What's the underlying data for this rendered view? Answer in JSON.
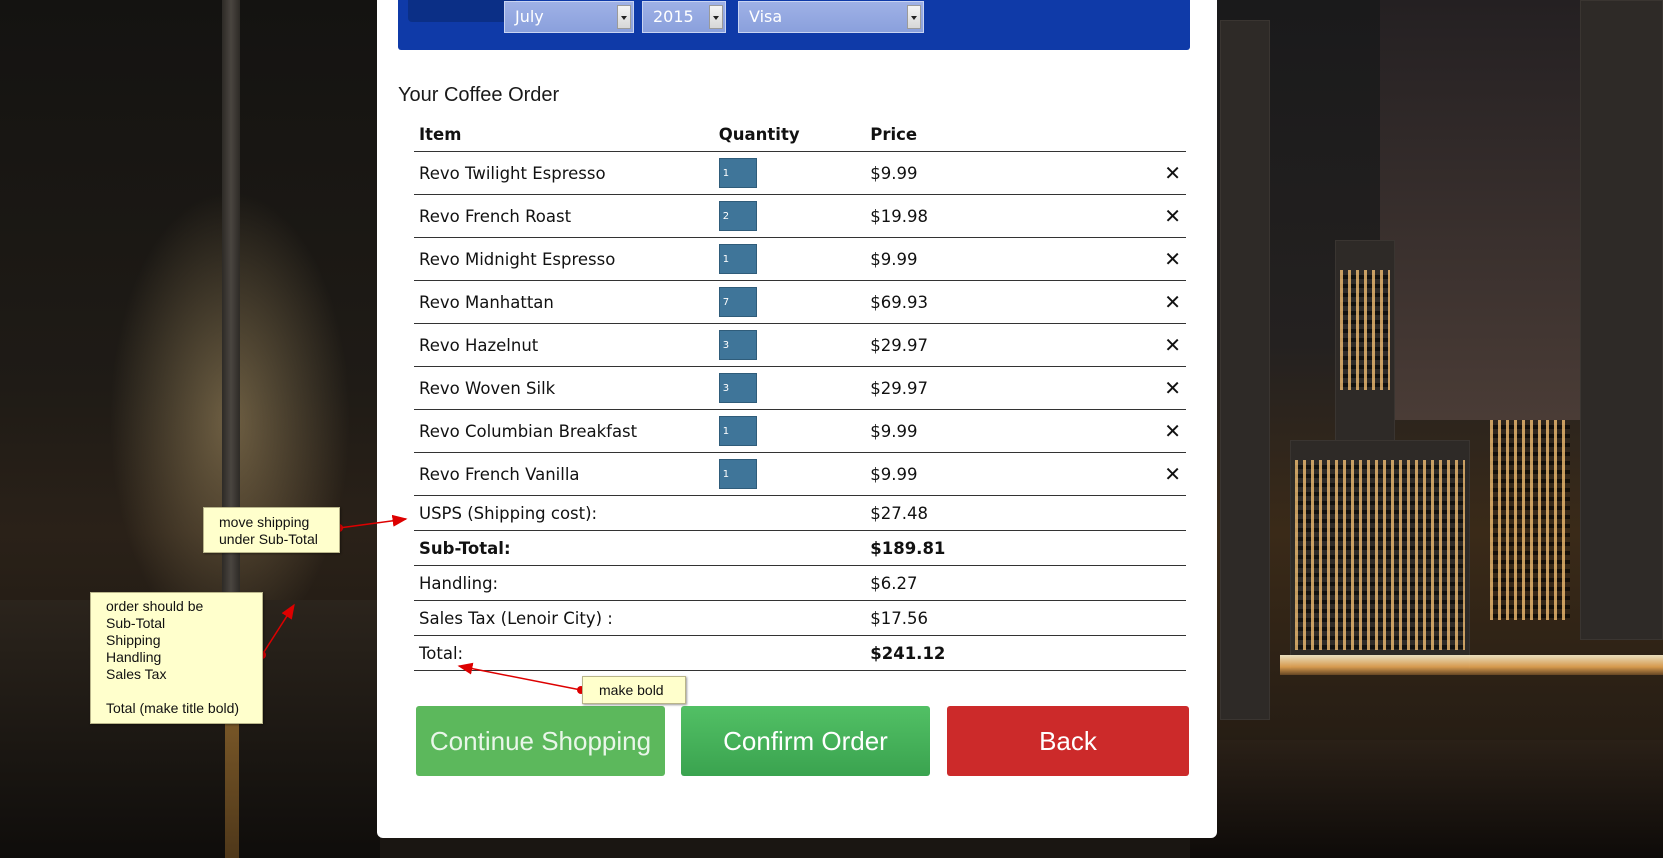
{
  "payment": {
    "month": "July",
    "year": "2015",
    "card_type": "Visa"
  },
  "order": {
    "title": "Your Coffee Order",
    "columns": {
      "item": "Item",
      "quantity": "Quantity",
      "price": "Price"
    },
    "items": [
      {
        "name": "Revo Twilight Espresso",
        "qty": "1",
        "price": "$9.99"
      },
      {
        "name": "Revo French Roast",
        "qty": "2",
        "price": "$19.98"
      },
      {
        "name": "Revo Midnight Espresso",
        "qty": "1",
        "price": "$9.99"
      },
      {
        "name": "Revo Manhattan",
        "qty": "7",
        "price": "$69.93"
      },
      {
        "name": "Revo Hazelnut",
        "qty": "3",
        "price": "$29.97"
      },
      {
        "name": "Revo Woven Silk",
        "qty": "3",
        "price": "$29.97"
      },
      {
        "name": "Revo Columbian Breakfast",
        "qty": "1",
        "price": "$9.99"
      },
      {
        "name": "Revo French Vanilla",
        "qty": "1",
        "price": "$9.99"
      }
    ],
    "remove_glyph": "✕",
    "shipping": {
      "label": "USPS (Shipping cost):",
      "value": "$27.48"
    },
    "subtotal": {
      "label": "Sub-Total:",
      "value": "$189.81"
    },
    "handling": {
      "label": "Handling:",
      "value": "$6.27"
    },
    "sales_tax": {
      "label": "Sales Tax (Lenoir City) :",
      "value": "$17.56"
    },
    "total": {
      "label": "Total:",
      "value": "$241.12"
    }
  },
  "buttons": {
    "continue": "Continue Shopping",
    "confirm": "Confirm Order",
    "back": "Back"
  },
  "annotations": {
    "note1": "move shipping\nunder Sub-Total",
    "note2": "order should be\nSub-Total\nShipping\nHandling\nSales Tax\n\nTotal (make title bold)",
    "note3": "make bold"
  },
  "colors": {
    "header_bar": "#0f3aa8",
    "qty_box": "#3f7599",
    "continue": "#5cb85c",
    "confirm": "#3aa34f",
    "back": "#cc2a2a",
    "note_bg": "#ffffcc",
    "arrow": "#dd0000"
  }
}
